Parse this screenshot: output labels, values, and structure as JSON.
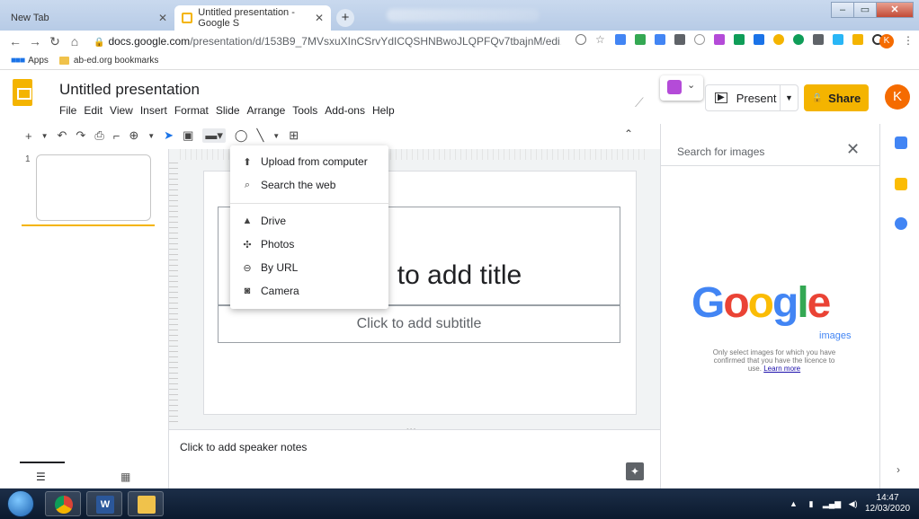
{
  "browser": {
    "tabs": [
      {
        "label": "New Tab",
        "active": false
      },
      {
        "label": "Untitled presentation - Google S",
        "active": true
      }
    ],
    "new_tab": "+",
    "url_host": "docs.google.com",
    "url_path": "/presentation/d/153B9_7MVsxuXInCSrvYdICQSHNBwoJLQPFQv7tbajnM/edi...",
    "bookmarks": [
      {
        "label": "Apps"
      },
      {
        "label": "ab-ed.org bookmarks"
      }
    ],
    "profile_initial": "K"
  },
  "app": {
    "title": "Untitled presentation",
    "menu": [
      "File",
      "Edit",
      "View",
      "Insert",
      "Format",
      "Slide",
      "Arrange",
      "Tools",
      "Add-ons",
      "Help"
    ],
    "present_label": "Present",
    "share_label": "Share",
    "avatar_initial": "K",
    "brand_color": "#f4b400"
  },
  "filmstrip": {
    "slide_number": "1"
  },
  "slide": {
    "title_placeholder": "to add title",
    "subtitle_placeholder": "Click to add subtitle"
  },
  "notes": {
    "placeholder": "Click to add speaker notes"
  },
  "insert_image_menu": {
    "items": [
      {
        "label": "Upload from computer",
        "icon": "upload-icon"
      },
      {
        "label": "Search the web",
        "icon": "search-icon"
      },
      {
        "label": "Drive",
        "icon": "drive-icon"
      },
      {
        "label": "Photos",
        "icon": "photos-icon"
      },
      {
        "label": "By URL",
        "icon": "link-icon"
      },
      {
        "label": "Camera",
        "icon": "camera-icon"
      }
    ]
  },
  "image_panel": {
    "search_placeholder": "Search for images",
    "logo_letters": [
      "G",
      "o",
      "o",
      "g",
      "l",
      "e"
    ],
    "logo_sub": "images",
    "disclaimer": "Only select images for which you have confirmed that you have the licence to use.",
    "learn_more": "Learn more"
  },
  "taskbar": {
    "word_letter": "W",
    "time": "14:47",
    "date": "12/03/2020"
  }
}
